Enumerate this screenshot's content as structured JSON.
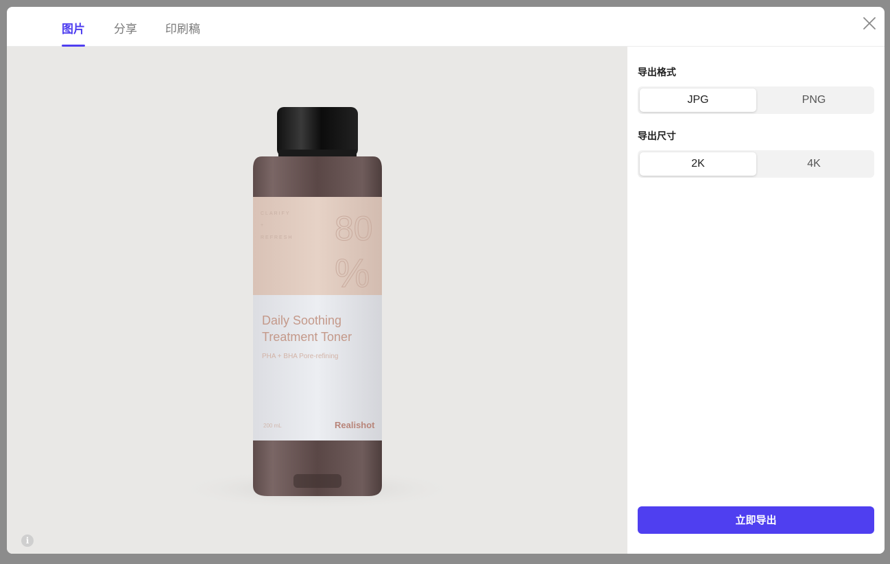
{
  "tabs": [
    {
      "label": "图片",
      "active": true
    },
    {
      "label": "分享",
      "active": false
    },
    {
      "label": "印刷稿",
      "active": false
    }
  ],
  "close_icon": "close-icon",
  "preview": {
    "product": {
      "label_top_lines": [
        "CLARIFY",
        "+",
        "REFRESH"
      ],
      "big_number": "80",
      "big_percent": "%",
      "title_line1": "Daily Soothing",
      "title_line2": "Treatment Toner",
      "subtitle": "PHA + BHA Pore-refining",
      "volume": "200 mL",
      "brand": "Realishot"
    },
    "info_icon": "info-icon"
  },
  "panel": {
    "format_label": "导出格式",
    "format_options": [
      "JPG",
      "PNG"
    ],
    "format_selected": "JPG",
    "size_label": "导出尺寸",
    "size_options": [
      "2K",
      "4K"
    ],
    "size_selected": "2K",
    "export_button": "立即导出"
  },
  "colors": {
    "accent": "#4f3ff0",
    "preview_bg": "#e9e8e6",
    "overlay": "#8c8c8c"
  }
}
